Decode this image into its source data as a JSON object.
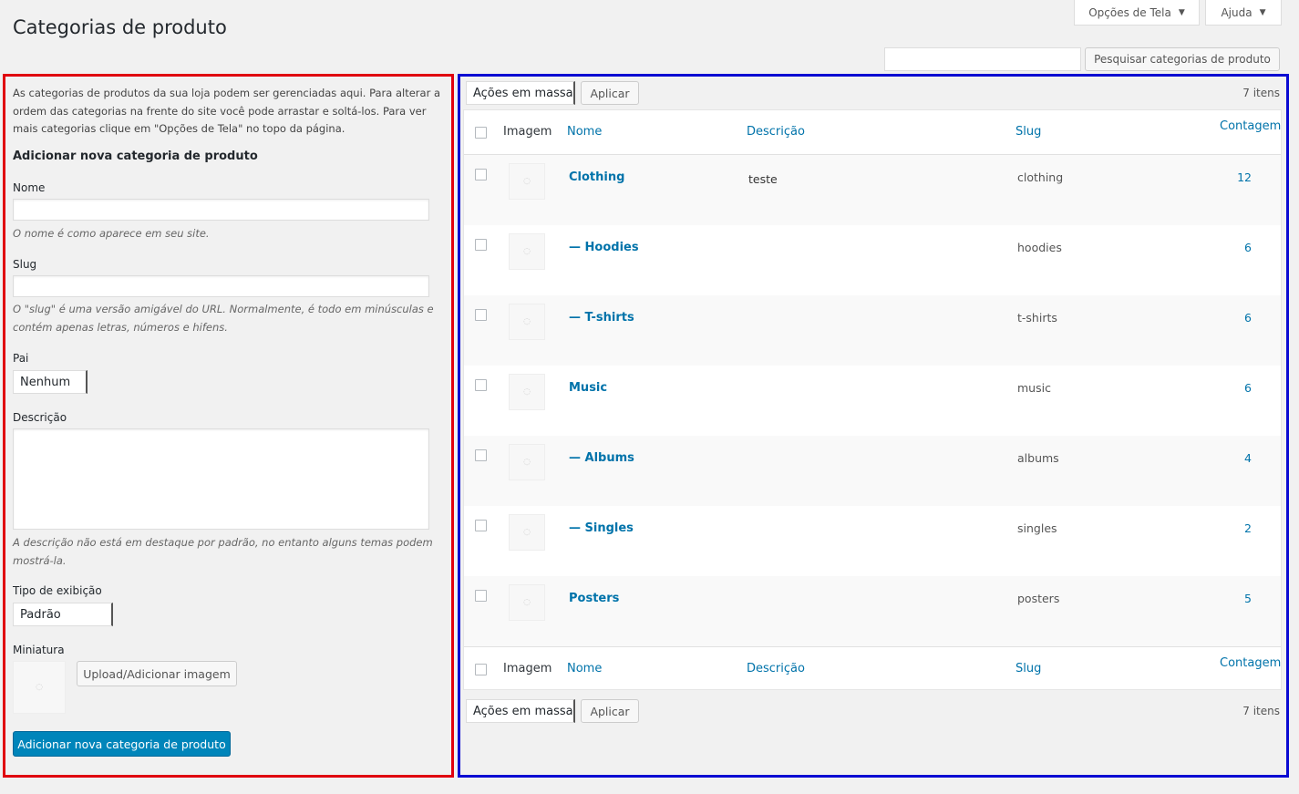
{
  "page": {
    "title": "Categorias de produto"
  },
  "top_buttons": {
    "screen_options": "Opções de Tela",
    "help": "Ajuda"
  },
  "search": {
    "placeholder": "",
    "button": "Pesquisar categorias de produto"
  },
  "form": {
    "intro": "As categorias de produtos da sua loja podem ser gerenciadas aqui. Para alterar a ordem das categorias na frente do site você pode arrastar e soltá-los. Para ver mais categorias clique em \"Opções de Tela\" no topo da página.",
    "heading": "Adicionar nova categoria de produto",
    "name_label": "Nome",
    "name_value": "",
    "name_hint": "O nome é como aparece em seu site.",
    "slug_label": "Slug",
    "slug_value": "",
    "slug_hint": "O \"slug\" é uma versão amigável do URL. Normalmente, é todo em minúsculas e contém apenas letras, números e hifens.",
    "parent_label": "Pai",
    "parent_value": "Nenhum",
    "desc_label": "Descrição",
    "desc_value": "",
    "desc_hint": "A descrição não está em destaque por padrão, no entanto alguns temas podem mostrá-la.",
    "display_label": "Tipo de exibição",
    "display_value": "Padrão",
    "thumb_label": "Miniatura",
    "upload_button": "Upload/Adicionar imagem",
    "submit_button": "Adicionar nova categoria de produto"
  },
  "bulk": {
    "select_value": "Ações em massa",
    "apply": "Aplicar",
    "count": "7 itens"
  },
  "table": {
    "columns": {
      "image": "Imagem",
      "name": "Nome",
      "description": "Descrição",
      "slug": "Slug",
      "count": "Contagem"
    },
    "rows": [
      {
        "name": "Clothing",
        "description": "teste",
        "slug": "clothing",
        "count": "12"
      },
      {
        "name": "— Hoodies",
        "description": "",
        "slug": "hoodies",
        "count": "6"
      },
      {
        "name": "— T-shirts",
        "description": "",
        "slug": "t-shirts",
        "count": "6"
      },
      {
        "name": "Music",
        "description": "",
        "slug": "music",
        "count": "6"
      },
      {
        "name": "— Albums",
        "description": "",
        "slug": "albums",
        "count": "4"
      },
      {
        "name": "— Singles",
        "description": "",
        "slug": "singles",
        "count": "2"
      },
      {
        "name": "Posters",
        "description": "",
        "slug": "posters",
        "count": "5"
      }
    ]
  },
  "colors": {
    "highlight_left": "#e0000f",
    "highlight_right": "#0a0ad2",
    "primary": "#0085ba",
    "link": "#0073aa"
  }
}
